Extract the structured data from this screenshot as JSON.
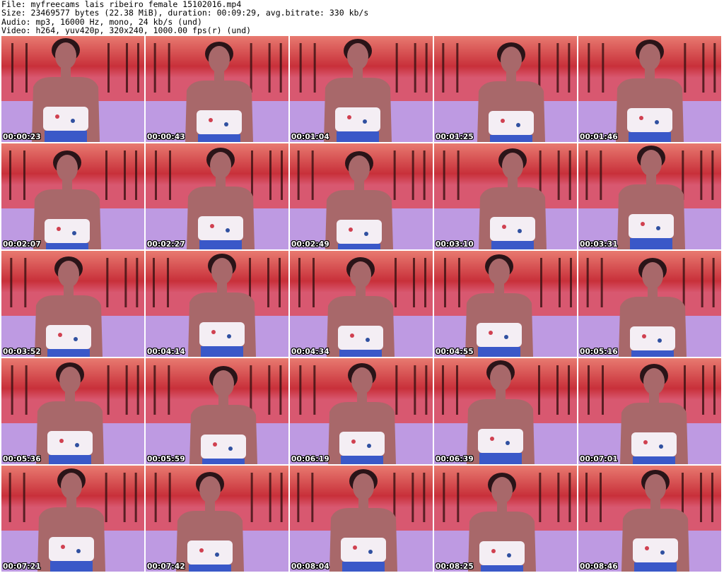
{
  "header": {
    "file_line": "File: myfreecams_lais_ribeiro_female_15102016.mp4",
    "size_line": "Size: 23469577 bytes (22.38 MiB), duration: 00:09:29, avg.bitrate: 330 kb/s",
    "audio_line": "Audio: mp3, 16000 Hz, mono, 24 kb/s (und)",
    "video_line": "Video: h264, yuv420p, 320x240, 1000.00 fps(r) (und)"
  },
  "colors": {
    "background_top": "#c8303a",
    "background_sky": "#e87a70",
    "floor": "#b8a8e8",
    "skin": "#a8686a",
    "hair": "#2a1418",
    "top_garment": "#f4eef4",
    "shorts": "#3a58c8"
  },
  "thumbnails": [
    {
      "timestamp": "00:00:23"
    },
    {
      "timestamp": "00:00:43"
    },
    {
      "timestamp": "00:01:04"
    },
    {
      "timestamp": "00:01:25"
    },
    {
      "timestamp": "00:01:46"
    },
    {
      "timestamp": "00:02:07"
    },
    {
      "timestamp": "00:02:27"
    },
    {
      "timestamp": "00:02:49"
    },
    {
      "timestamp": "00:03:10"
    },
    {
      "timestamp": "00:03:31"
    },
    {
      "timestamp": "00:03:52"
    },
    {
      "timestamp": "00:04:14"
    },
    {
      "timestamp": "00:04:34"
    },
    {
      "timestamp": "00:04:55"
    },
    {
      "timestamp": "00:05:16"
    },
    {
      "timestamp": "00:05:36"
    },
    {
      "timestamp": "00:05:59"
    },
    {
      "timestamp": "00:06:19"
    },
    {
      "timestamp": "00:06:39"
    },
    {
      "timestamp": "00:07:01"
    },
    {
      "timestamp": "00:07:21"
    },
    {
      "timestamp": "00:07:42"
    },
    {
      "timestamp": "00:08:04"
    },
    {
      "timestamp": "00:08:25"
    },
    {
      "timestamp": "00:08:46"
    }
  ]
}
